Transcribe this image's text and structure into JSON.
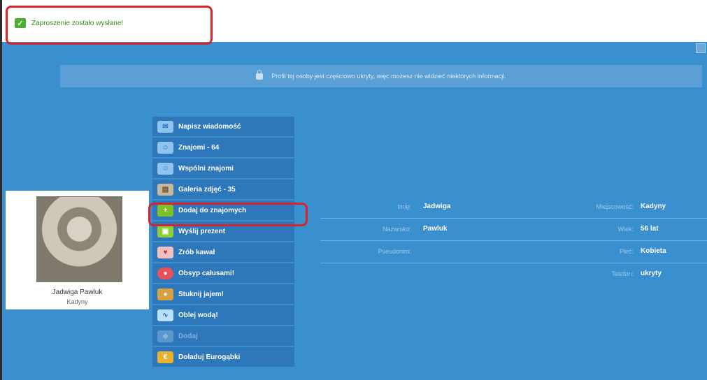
{
  "status": {
    "message": "Zaproszenie zostało wysłane!"
  },
  "notice": {
    "text": "Profil tej osoby jest częściowo ukryty, więc możesz nie widzieć niektórych informacji."
  },
  "profile": {
    "name": "Jadwiga Pawluk",
    "city": "Kadyny"
  },
  "menu": [
    {
      "label": "Napisz wiadomość",
      "icon": "envelope-icon",
      "icon_color": "#8fc4ee"
    },
    {
      "label": "Znajomi - 64",
      "icon": "friends-icon",
      "icon_color": "#8fc4ee"
    },
    {
      "label": "Wspólni znajomi",
      "icon": "mutual-friends-icon",
      "icon_color": "#8fc4ee"
    },
    {
      "label": "Galeria zdjęć - 35",
      "icon": "photo-gallery-icon",
      "icon_color": "#c9b8a0"
    },
    {
      "label": "Dodaj do znajomych",
      "icon": "add-friend-icon",
      "icon_color": "#7fbf2a"
    },
    {
      "label": "Wyślij prezent",
      "icon": "gift-icon",
      "icon_color": "#8ccf3a"
    },
    {
      "label": "Zrób kawał",
      "icon": "prank-icon",
      "icon_color": "#f0c0c0"
    },
    {
      "label": "Obsyp całusami!",
      "icon": "kiss-icon",
      "icon_color": "#e8505a"
    },
    {
      "label": "Stuknij jajem!",
      "icon": "egg-icon",
      "icon_color": "#d8a040"
    },
    {
      "label": "Oblej wodą!",
      "icon": "water-icon",
      "icon_color": "#b8e0fa"
    },
    {
      "label": "Dodaj",
      "icon": "disabled-item-icon",
      "icon_color": "#5a97cf"
    },
    {
      "label": "Doładuj Eurogąbki",
      "icon": "eurosponge-icon",
      "icon_color": "#e8b230"
    }
  ],
  "details": {
    "rows": [
      {
        "l1": "Imię:",
        "v1": "Jadwiga",
        "l2": "Miejscowość:",
        "v2": "Kadyny"
      },
      {
        "l1": "Nazwisko:",
        "v1": "Pawluk",
        "l2": "Wiek:",
        "v2": "56 lat"
      },
      {
        "l1": "Pseudonim:",
        "v1": "",
        "l2": "Płeć:",
        "v2": "Kobieta"
      },
      {
        "l1": "",
        "v1": "",
        "l2": "Telefon:",
        "v2": "ukryty"
      }
    ]
  }
}
